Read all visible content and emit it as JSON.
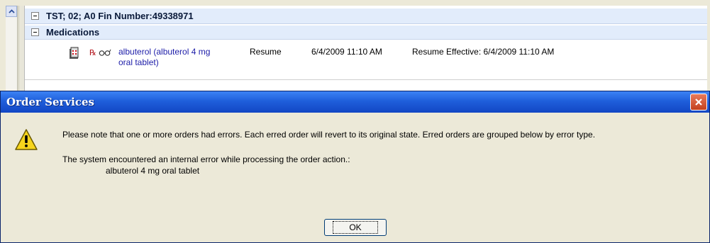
{
  "order_window": {
    "header": "TST; 02; A0  Fin Number:49338971",
    "section": "Medications",
    "medication": {
      "name_line1": "albuterol (albuterol 4 mg",
      "name_line2": "oral tablet)",
      "action": "Resume",
      "datetime": "6/4/2009 11:10 AM",
      "detail": "Resume Effective: 6/4/2009 11:10 AM",
      "icons": [
        "order-sheet-icon",
        "prescription-icon",
        "glasses-icon"
      ]
    }
  },
  "dialog": {
    "title": "Order Services",
    "message_line1": "Please note that one or more orders had errors.  Each erred order will revert to its original state.  Erred orders are grouped below by error type.",
    "message_line2": "The system encountered an internal error while processing the order action.:",
    "message_line3": "albuterol 4 mg oral tablet",
    "ok_label": "OK",
    "icon": "warning-icon"
  },
  "colors": {
    "titlebar": "#1f5fdb",
    "dialog_bg": "#ece9d8",
    "header_row_bg": "#e2ecfb",
    "med_link": "#1c1ca8",
    "close_button": "#c3401e"
  }
}
